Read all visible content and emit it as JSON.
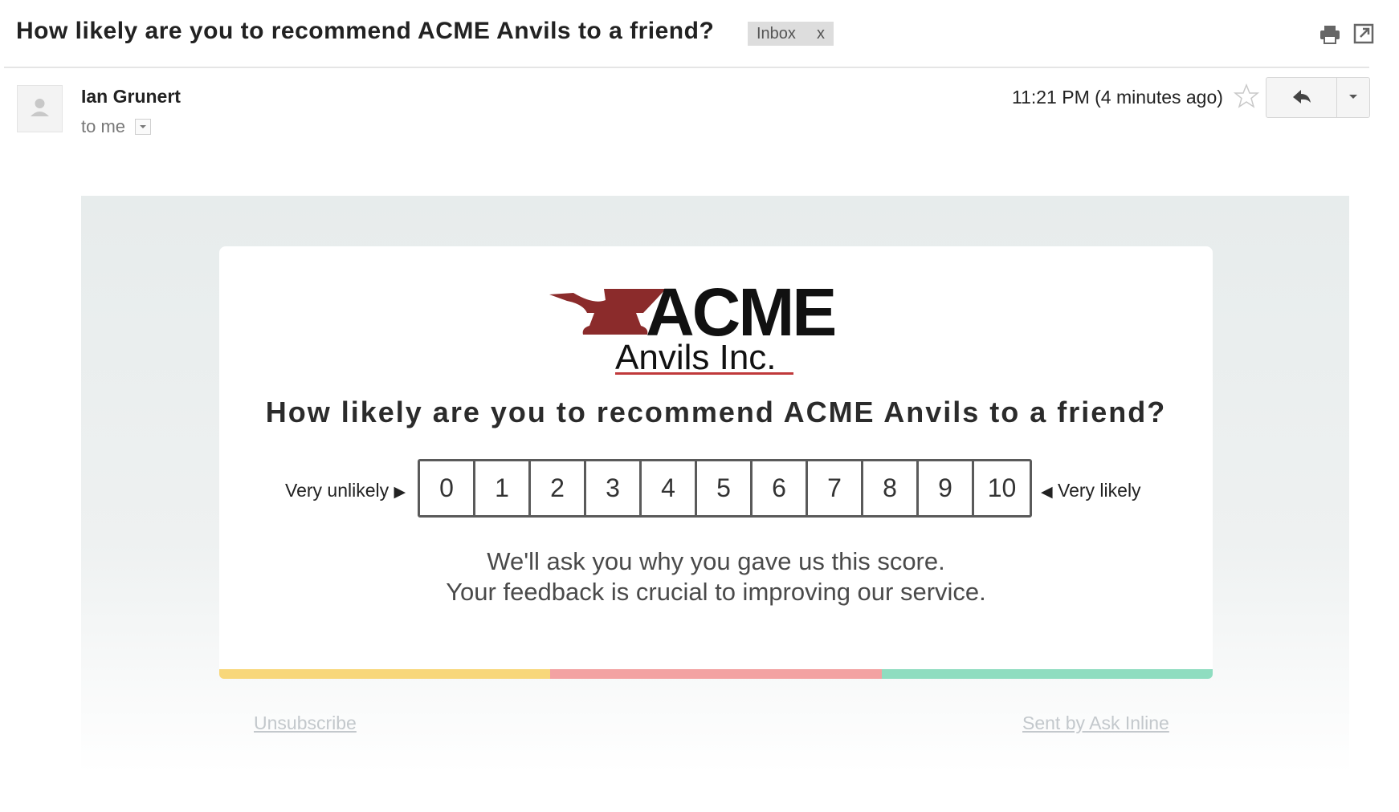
{
  "header": {
    "subject": "How likely are you to recommend ACME Anvils to a friend?",
    "label_chip": {
      "text": "Inbox",
      "remove": "x"
    },
    "icons": [
      "print-icon",
      "popout-icon"
    ]
  },
  "sender": {
    "name": "Ian Grunert",
    "to": "to me",
    "time": "11:21 PM (4 minutes ago)",
    "icons": [
      "avatar-placeholder-icon",
      "chevron-down-icon",
      "star-icon",
      "reply-icon",
      "caret-down-icon"
    ]
  },
  "logo": {
    "brand": "ACME",
    "subtitle": "Anvils Inc.",
    "anvil_color": "#8b2b2b"
  },
  "survey": {
    "question": "How likely are you to recommend ACME Anvils to a friend?",
    "low_label": "Very unlikely",
    "high_label": "Very likely",
    "scores": [
      "0",
      "1",
      "2",
      "3",
      "4",
      "5",
      "6",
      "7",
      "8",
      "9",
      "10"
    ],
    "note_line1": "We'll ask you why you gave us this score.",
    "note_line2": "Your feedback is crucial to improving our service."
  },
  "colors": {
    "bar": [
      "#f8d77a",
      "#f3a2a2",
      "#8fddc0"
    ],
    "card_background": "#e7ecec"
  },
  "footer": {
    "unsubscribe": "Unsubscribe",
    "sent_by": "Sent by Ask Inline"
  }
}
